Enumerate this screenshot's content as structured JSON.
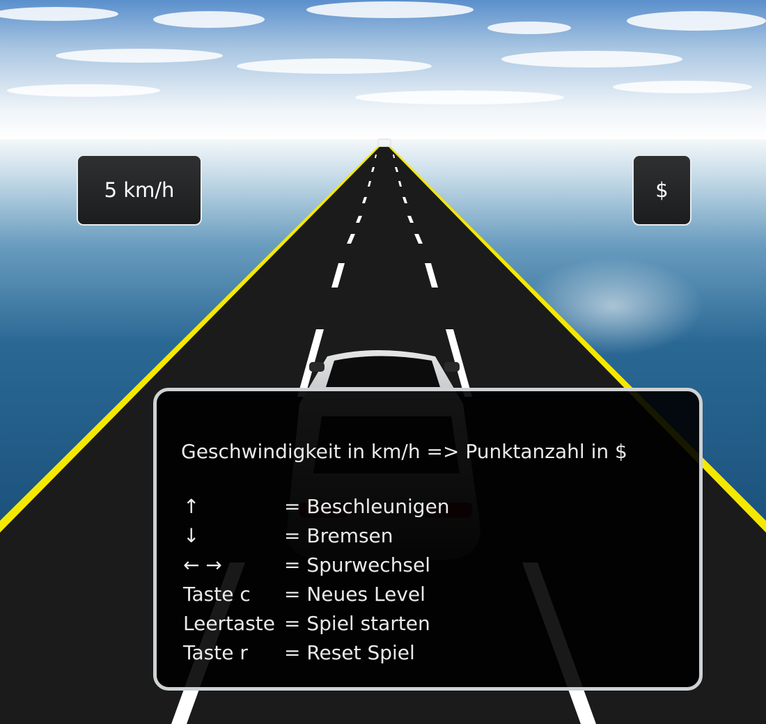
{
  "hud": {
    "speed": "5 km/h",
    "score": "$"
  },
  "help": {
    "title": "Geschwindigkeit in km/h => Punktanzahl in $",
    "controls": [
      {
        "key": "↑",
        "action": "= Beschleunigen"
      },
      {
        "key": "↓",
        "action": "= Bremsen"
      },
      {
        "key": "← →",
        "action": "= Spurwechsel"
      },
      {
        "key": "Taste c",
        "action": "= Neues Level"
      },
      {
        "key": "Leertaste",
        "action": "= Spiel starten"
      },
      {
        "key": "Taste r",
        "action": "= Reset Spiel"
      }
    ]
  },
  "colors": {
    "sky_top": "#5b8fcb",
    "horizon": "#f2f7fa",
    "sea": "#0a3a63",
    "road": "#1b1b1b",
    "road_edge": "#f5e800",
    "lane_marking": "#ffffff",
    "car_body": "#d9dadb"
  }
}
